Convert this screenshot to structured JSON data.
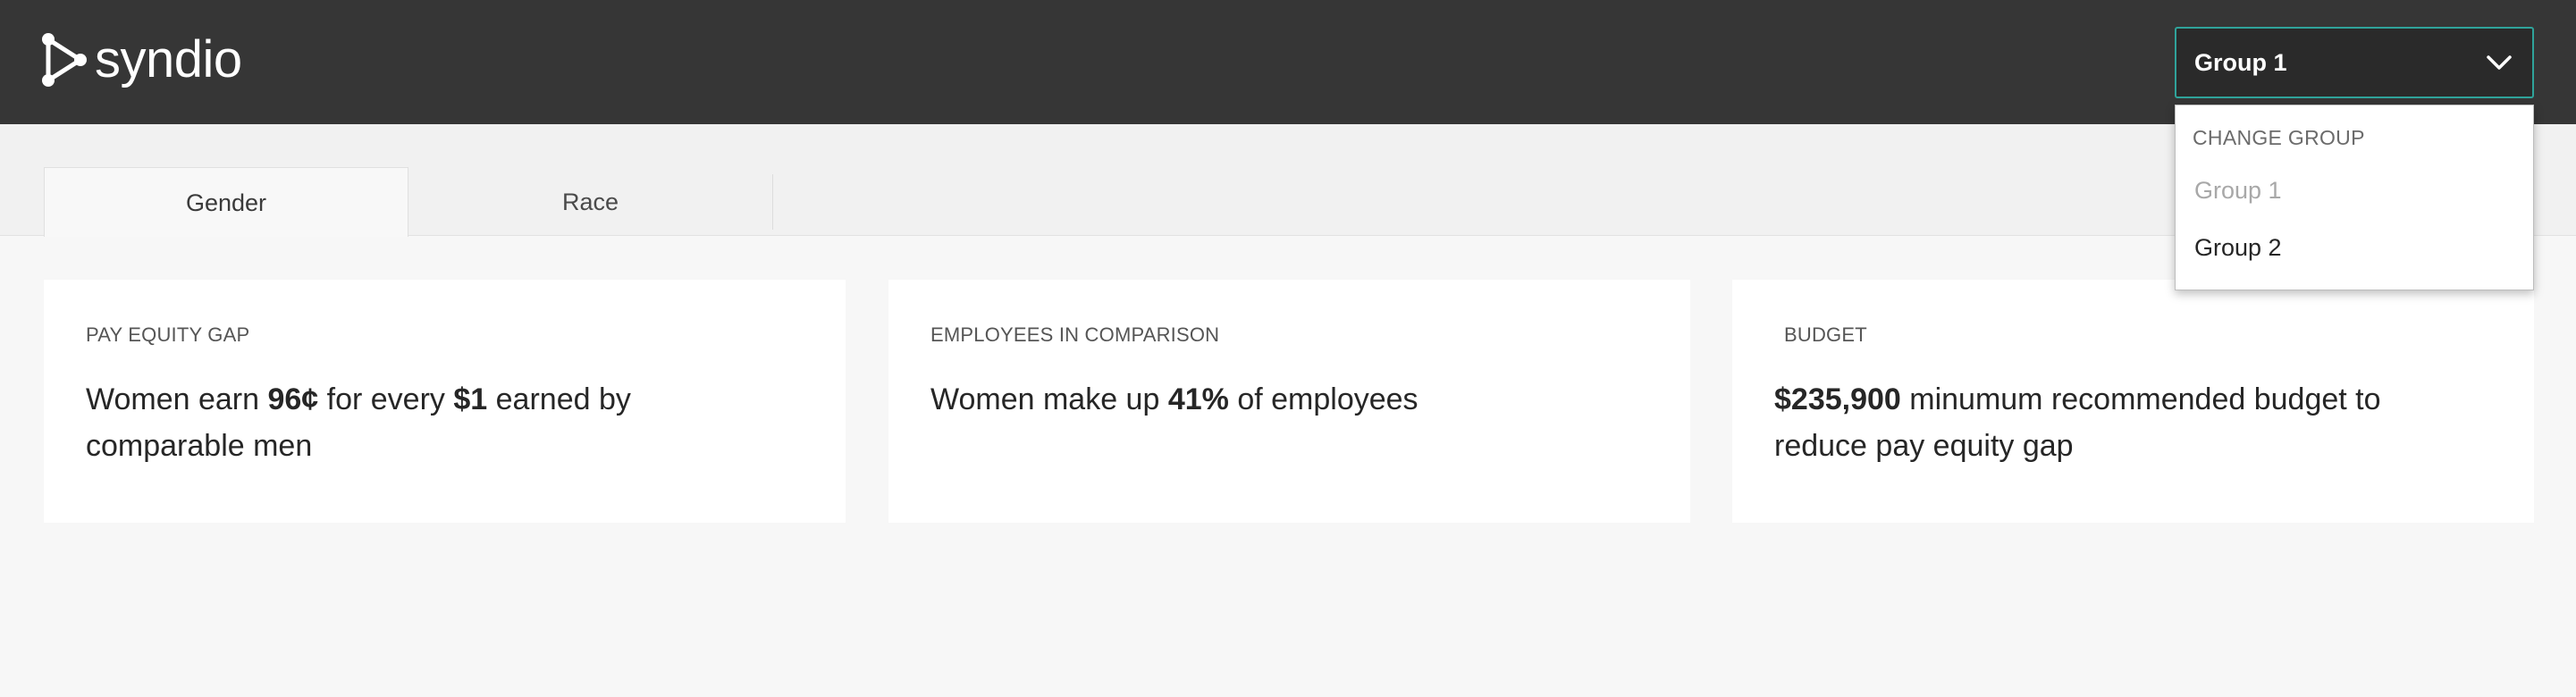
{
  "header": {
    "logo_text": "syndio",
    "group_select": {
      "value": "Group 1"
    }
  },
  "dropdown": {
    "header": "CHANGE GROUP",
    "items": [
      {
        "label": "Group 1",
        "state": "disabled"
      },
      {
        "label": "Group 2",
        "state": "enabled"
      }
    ]
  },
  "tabs": [
    {
      "label": "Gender",
      "selected": true
    },
    {
      "label": "Race",
      "selected": false
    }
  ],
  "cards": [
    {
      "label": "PAY EQUITY GAP",
      "parts": {
        "a": "Women earn ",
        "b": "96¢",
        "c": " for every ",
        "d": "$1",
        "e": " earned by comparable men"
      }
    },
    {
      "label": "EMPLOYEES IN COMPARISON",
      "parts": {
        "a": "Women make up ",
        "b": "41%",
        "c": " of employees"
      }
    },
    {
      "label": "BUDGET",
      "parts": {
        "a": "$235,900",
        "b": " minumum recommended budget to reduce pay equity gap"
      }
    }
  ],
  "colors": {
    "topbar": "#363636",
    "accent_border": "#2fa39a",
    "background": "#f7f7f7"
  }
}
